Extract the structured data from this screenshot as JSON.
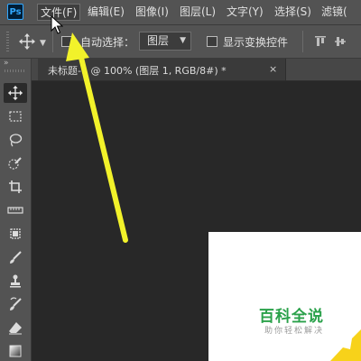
{
  "app": {
    "logo_text": "Ps"
  },
  "menubar": {
    "items": [
      {
        "label": "文件(F)"
      },
      {
        "label": "编辑(E)"
      },
      {
        "label": "图像(I)"
      },
      {
        "label": "图层(L)"
      },
      {
        "label": "文字(Y)"
      },
      {
        "label": "选择(S)"
      },
      {
        "label": "滤镜("
      }
    ]
  },
  "options": {
    "autoselect_label": "自动选择：",
    "layer_select_value": "图层",
    "transform_label": "显示变换控件"
  },
  "toolbar": {
    "collapse_glyph": "»",
    "tools": [
      {
        "icon": "move-tool-icon",
        "active": true
      },
      {
        "icon": "marquee-tool-icon"
      },
      {
        "icon": "lasso-tool-icon"
      },
      {
        "icon": "quick-selection-tool-icon"
      },
      {
        "icon": "crop-tool-icon"
      },
      {
        "icon": "ruler-tool-icon"
      },
      {
        "icon": "healing-brush-tool-icon"
      },
      {
        "icon": "brush-tool-icon"
      },
      {
        "icon": "clone-stamp-tool-icon"
      },
      {
        "icon": "history-brush-tool-icon"
      },
      {
        "icon": "eraser-tool-icon"
      },
      {
        "icon": "gradient-tool-icon"
      }
    ]
  },
  "document": {
    "tab_title": "未标题-1 @ 100% (图层 1, RGB/8#) *",
    "close_glyph": "×"
  },
  "watermark": {
    "title": "百科全说",
    "subtitle": "助你轻松解决"
  },
  "colors": {
    "arrow": "#f2f22a",
    "watermark_green": "#2aa14a",
    "watermark_corner": "#f7d21a"
  }
}
